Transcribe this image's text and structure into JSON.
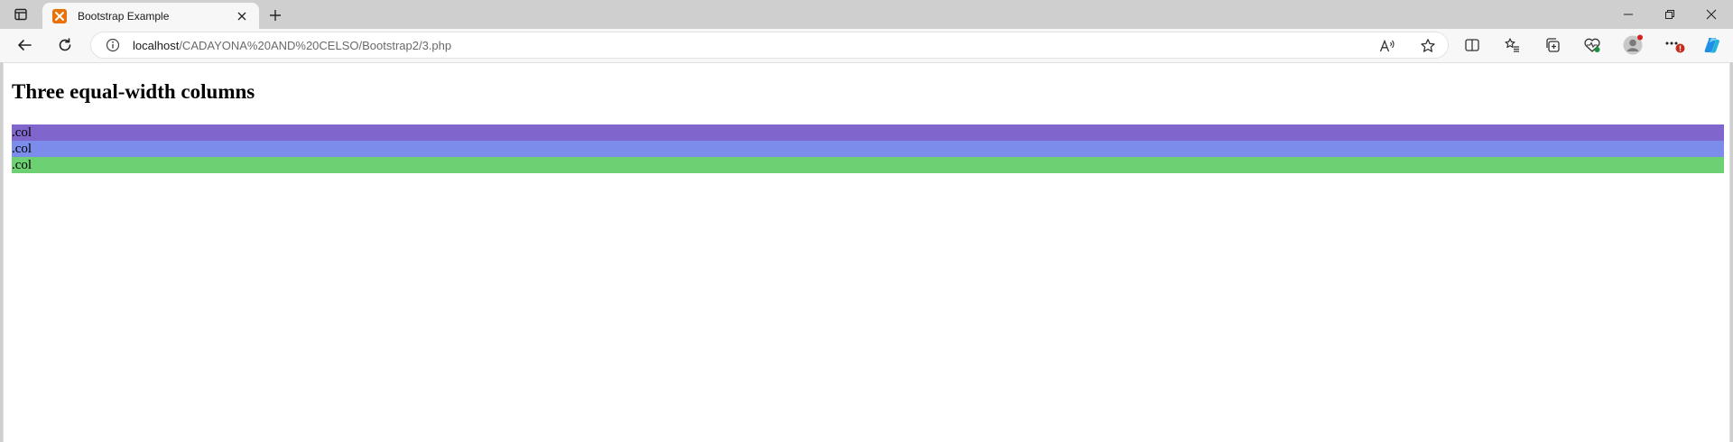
{
  "browser": {
    "tab": {
      "title": "Bootstrap Example",
      "favicon": "xampp-favicon-icon"
    },
    "address": {
      "host": "localhost",
      "path": "/CADAYONA%20AND%20CELSO/Bootstrap2/3.php"
    },
    "colors": {
      "accent": "#e8710a",
      "chrome": "#cfcfcf",
      "toolbar": "#f7f7f7"
    }
  },
  "page": {
    "heading": "Three equal-width columns",
    "columns": [
      {
        "label": ".col",
        "color": "#8066cc"
      },
      {
        "label": ".col",
        "color": "#7b8ceb"
      },
      {
        "label": ".col",
        "color": "#6dd072"
      }
    ]
  }
}
